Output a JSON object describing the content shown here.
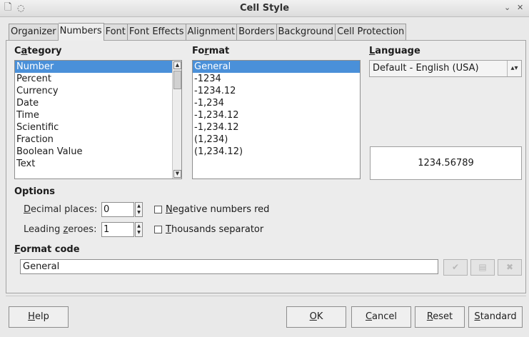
{
  "window": {
    "title": "Cell Style"
  },
  "tabs": [
    "Organizer",
    "Numbers",
    "Font",
    "Font Effects",
    "Alignment",
    "Borders",
    "Background",
    "Cell Protection"
  ],
  "active_tab": "Numbers",
  "category": {
    "label_pre": "C",
    "label_mn": "a",
    "label_post": "tegory",
    "items": [
      "Number",
      "Percent",
      "Currency",
      "Date",
      "Time",
      "Scientific",
      "Fraction",
      "Boolean Value",
      "Text"
    ],
    "selected": "Number"
  },
  "format": {
    "label_pre": "Fo",
    "label_mn": "r",
    "label_post": "mat",
    "items": [
      "General",
      "-1234",
      "-1234.12",
      "-1,234",
      "-1,234.12",
      "-1,234.12",
      "(1,234)",
      "(1,234.12)"
    ],
    "selected": "General"
  },
  "language": {
    "label_pre": "",
    "label_mn": "L",
    "label_post": "anguage",
    "value": "Default - English (USA)"
  },
  "preview": {
    "value": "1234.56789"
  },
  "options": {
    "heading": "Options",
    "decimal_label_mn": "D",
    "decimal_label_post": "ecimal places:",
    "decimal_value": "0",
    "leading_label_pre": "Leading ",
    "leading_label_mn": "z",
    "leading_label_post": "eroes:",
    "leading_value": "1",
    "negative_red_mn": "N",
    "negative_red_post": "egative numbers red",
    "thousands_mn": "T",
    "thousands_post": "housands separator"
  },
  "format_code": {
    "label_pre": "",
    "label_mn": "F",
    "label_post": "ormat code",
    "value": "General"
  },
  "buttons": {
    "help_mn": "H",
    "help_post": "elp",
    "ok_mn": "O",
    "ok_post": "K",
    "cancel_mn": "C",
    "cancel_post": "ancel",
    "reset_mn": "R",
    "reset_post": "eset",
    "standard_mn": "S",
    "standard_post": "tandard"
  },
  "colors": {
    "selection": "#4a90d9",
    "window_bg": "#e9e9e9"
  },
  "icons": [
    "new-document-icon",
    "window-menu-icon",
    "minimize-icon",
    "close-icon",
    "checkmark-icon",
    "comment-icon",
    "delete-icon"
  ]
}
